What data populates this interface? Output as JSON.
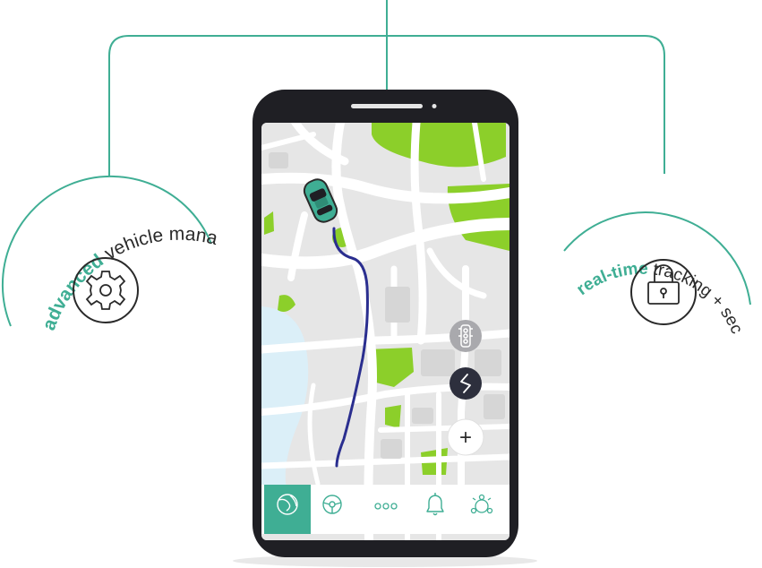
{
  "colors": {
    "accent": "#3fae94",
    "phone_body": "#1f1f24",
    "map_bg": "#e6e6e6",
    "road": "#ffffff",
    "park": "#8ccf2a",
    "water": "#dbeff8",
    "route": "#2a2e8f",
    "car": "#3fae94",
    "control_dark": "#2d2f3d",
    "control_gray": "#a9a9ad",
    "icon_stroke": "#2a2a2a"
  },
  "left_feature": {
    "emphasis": "advanced",
    "text": " vehicle management",
    "icon": "gear-icon"
  },
  "right_feature": {
    "emphasis": "real-time",
    "text": " tracking + security",
    "icon": "padlock-icon"
  },
  "map_controls": [
    {
      "name": "traffic-light-button",
      "icon": "traffic-light-icon",
      "style": "gray"
    },
    {
      "name": "route-button",
      "icon": "route-icon",
      "style": "dark"
    },
    {
      "name": "zoom-in-button",
      "icon": "plus-icon",
      "style": "light",
      "label": "+"
    }
  ],
  "bottom_nav": [
    {
      "name": "nav-map",
      "icon": "globe-icon",
      "active": true
    },
    {
      "name": "nav-driving",
      "icon": "steering-wheel-icon",
      "active": false
    },
    {
      "name": "nav-more",
      "icon": "more-dots-icon",
      "active": false
    },
    {
      "name": "nav-alerts",
      "icon": "bell-icon",
      "active": false
    },
    {
      "name": "nav-network",
      "icon": "network-icon",
      "active": false
    }
  ]
}
